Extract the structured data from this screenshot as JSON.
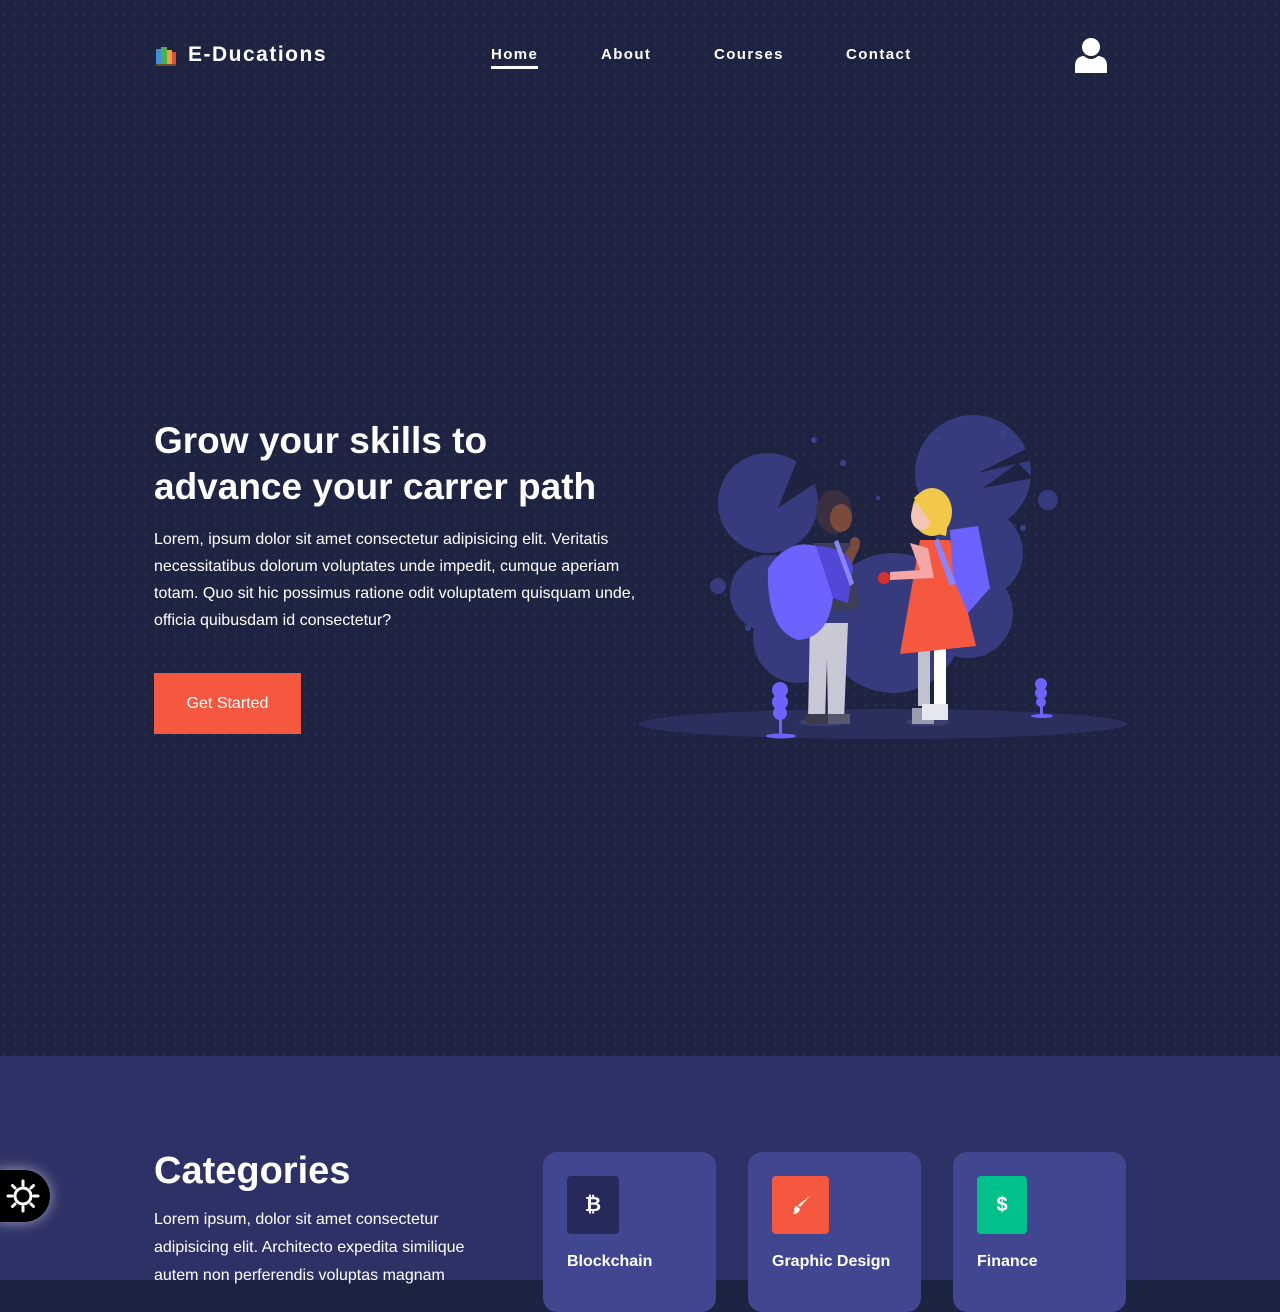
{
  "header": {
    "brand_name": "E-Ducations",
    "nav": [
      {
        "label": "Home",
        "active": true
      },
      {
        "label": "About",
        "active": false
      },
      {
        "label": "Courses",
        "active": false
      },
      {
        "label": "Contact",
        "active": false
      }
    ],
    "icons": {
      "brand": "books-icon",
      "account": "user-icon"
    }
  },
  "hero": {
    "headline_line1": "Grow your skills to",
    "headline_line2": "advance your carrer path",
    "lead": "Lorem, ipsum dolor sit amet consectetur adipisicing elit. Veritatis necessitatibus dolorum voluptates unde impedit, cumque aperiam totam. Quo sit hic possimus ratione odit voluptatem quisquam unde, officia quibusdam id consectetur?",
    "cta_label": "Get Started",
    "illustration": "students-with-backpacks-illustration"
  },
  "categories": {
    "title": "Categories",
    "description": "Lorem ipsum, dolor sit amet consectetur adipisicing elit. Architecto expedita similique autem non perferendis voluptas magnam",
    "items": [
      {
        "label": "Blockchain",
        "icon": "bitcoin-icon",
        "icon_glyph": "₿",
        "color": "#252a5a"
      },
      {
        "label": "Graphic Design",
        "icon": "paintbrush-icon",
        "icon_glyph": "",
        "color": "#f5583f"
      },
      {
        "label": "Finance",
        "icon": "dollar-icon",
        "icon_glyph": "$",
        "color": "#00c08b"
      }
    ]
  },
  "theme_toggle": {
    "icon": "sun-icon"
  },
  "colors": {
    "hero_bg": "#1d2340",
    "categories_bg": "#2e3166",
    "card_bg": "#40468f",
    "accent": "#f5583f",
    "text": "#ffffff"
  }
}
